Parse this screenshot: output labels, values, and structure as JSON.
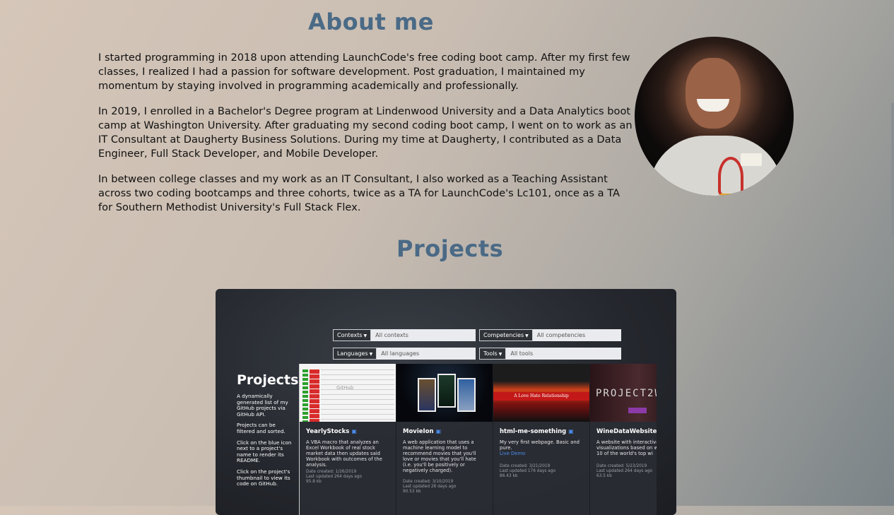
{
  "about": {
    "title": "About me",
    "paragraphs": [
      "I started programming in 2018 upon attending LaunchCode's free coding boot camp. After my first few classes, I realized I had a passion for software development. Post graduation, I maintained my momentum by staying involved in programming academically and professionally.",
      "In 2019, I enrolled in a Bachelor's Degree program at Lindenwood University and a Data Analytics boot camp at Washington University. After graduating my second coding boot camp, I went on to work as an IT Consultant at Daugherty Business Solutions. During my time at Daugherty, I contributed as a Data Engineer, Full Stack Developer, and Mobile Developer.",
      "In between college classes and my work as an IT Consultant, I also worked as a Teaching Assistant across two coding bootcamps and three cohorts, twice as a TA for LaunchCode's Lc101, once as a TA for Southern Methodist University's Full Stack Flex."
    ]
  },
  "projects": {
    "title": "Projects",
    "filters": [
      {
        "label": "Contexts",
        "value": "All contexts"
      },
      {
        "label": "Competencies",
        "value": "All competencies"
      },
      {
        "label": "Languages",
        "value": "All languages"
      },
      {
        "label": "Tools",
        "value": "All tools"
      }
    ],
    "sidebar": {
      "heading": "Projects",
      "notes": [
        "A dynamically generated list of my GitHub projects via GitHub API.",
        "Projects can be filtered and sorted.",
        "Click on the blue icon next to a project's name to render its README.",
        "Click on the project's thumbnail to view its code on GitHub."
      ]
    },
    "cards": [
      {
        "name": "YearlyStocks",
        "description": "A VBA macro that analyzes an Excel Workbook of real stock market data then updates said Workbook with outcomes of the analysis.",
        "created": "Date created: 1/26/2019",
        "updated": "Last updated 264 days ago",
        "size": "95.8 kb"
      },
      {
        "name": "MovieIon",
        "description": "A web application that uses a machine learning model to recommend movies that you'll love or movies that you'll hate (i.e. you'll be positively or negatively charged).",
        "created": "Date created: 3/10/2019",
        "updated": "Last updated 28 days ago",
        "size": "90.53 kb"
      },
      {
        "name": "html-me-something",
        "description": "My very first webpage. Basic and pure.",
        "link": "Live Demo",
        "created": "Date created: 3/21/2018",
        "updated": "Last updated 176 days ago",
        "size": "86.43 kb"
      },
      {
        "name": "WineDataWebsite",
        "description": "A website with interactive data visualizations based on wine from 10 of the world's top wi",
        "created": "Date created: 5/23/2019",
        "updated": "Last updated 264 days ago",
        "size": "63.5 kb"
      }
    ],
    "thumb_texts": {
      "github_overlay": "GitHub",
      "html_banner": "A Love Hate Relationship",
      "wine_banner": "PROJECT2W"
    }
  }
}
